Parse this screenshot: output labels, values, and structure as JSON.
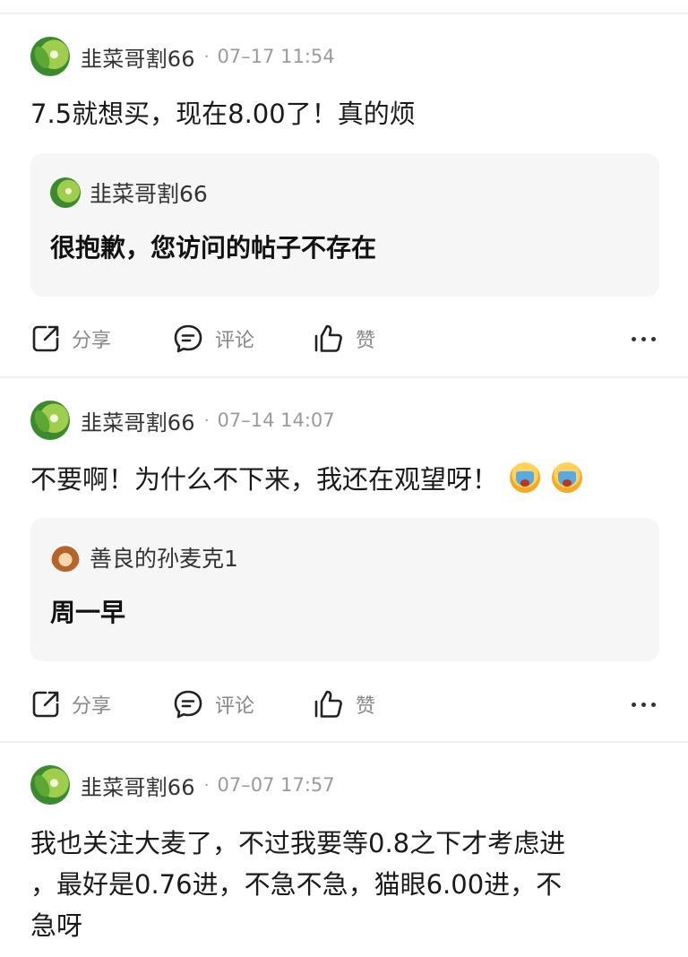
{
  "posts": [
    {
      "author": "韭菜哥割66",
      "separator": "·",
      "time": "07–17 11:54",
      "text": "7.5就想买，现在8.00了！真的烦",
      "quote": {
        "author": "韭菜哥割66",
        "text": "很抱歉，您访问的帖子不存在",
        "avatar_icon": "leaf-avatar"
      },
      "actions": {
        "share": "分享",
        "comment": "评论",
        "like": "赞"
      }
    },
    {
      "author": "韭菜哥割66",
      "separator": "·",
      "time": "07–14 14:07",
      "text": "不要啊！为什么不下来，我还在观望呀！",
      "emojis": [
        "crying-face-icon",
        "crying-face-icon"
      ],
      "quote": {
        "author": "善良的孙麦克1",
        "text": "周一早",
        "avatar_icon": "monkey-avatar"
      },
      "actions": {
        "share": "分享",
        "comment": "评论",
        "like": "赞"
      }
    },
    {
      "author": "韭菜哥割66",
      "separator": "·",
      "time": "07–07 17:57",
      "text_lines": [
        "我也关注大麦了，不过我要等0.8之下才考虑进",
        "，最好是0.76进，不急不急，猫眼6.00进，不",
        "急呀"
      ]
    }
  ],
  "colors": {
    "meta_gray": "#9a9a9a",
    "quote_bg": "#f6f6f6",
    "divider": "#f1f1f1"
  }
}
